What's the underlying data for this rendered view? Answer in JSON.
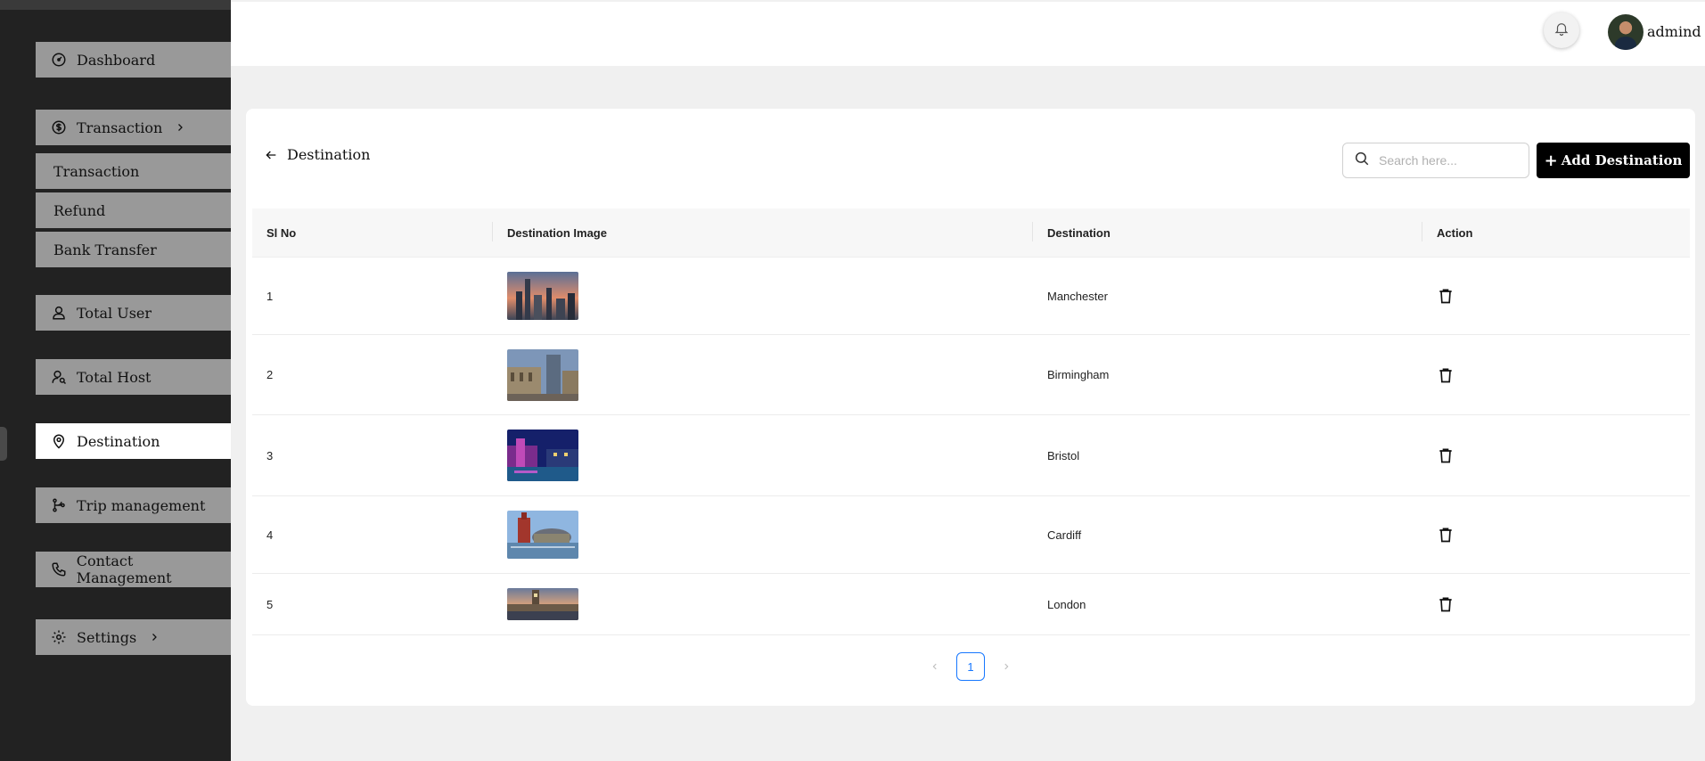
{
  "sidebar": {
    "items": [
      {
        "label": "Dashboard"
      },
      {
        "label": "Transaction"
      },
      {
        "label": "Transaction"
      },
      {
        "label": "Refund"
      },
      {
        "label": "Bank Transfer"
      },
      {
        "label": "Total User"
      },
      {
        "label": "Total Host"
      },
      {
        "label": "Destination"
      },
      {
        "label": "Trip management"
      },
      {
        "label": "Contact Management"
      },
      {
        "label": "Settings"
      }
    ]
  },
  "header": {
    "username": "admind",
    "icons": [
      "bell-icon",
      "avatar"
    ]
  },
  "page": {
    "title": "Destination",
    "search_placeholder": "Search here...",
    "add_button": "Add Destination"
  },
  "table": {
    "columns": [
      "Sl No",
      "Destination Image",
      "Destination",
      "Action"
    ],
    "rows": [
      {
        "sl": "1",
        "destination": "Manchester"
      },
      {
        "sl": "2",
        "destination": "Birmingham"
      },
      {
        "sl": "3",
        "destination": "Bristol"
      },
      {
        "sl": "4",
        "destination": "Cardiff"
      },
      {
        "sl": "5",
        "destination": "London"
      }
    ]
  },
  "pagination": {
    "current": "1"
  },
  "colors": {
    "sidebar_bg": "#222222",
    "nav_bg": "#999999",
    "active_bg": "#ffffff",
    "button_bg": "#000000",
    "page_link": "#1677ff"
  }
}
